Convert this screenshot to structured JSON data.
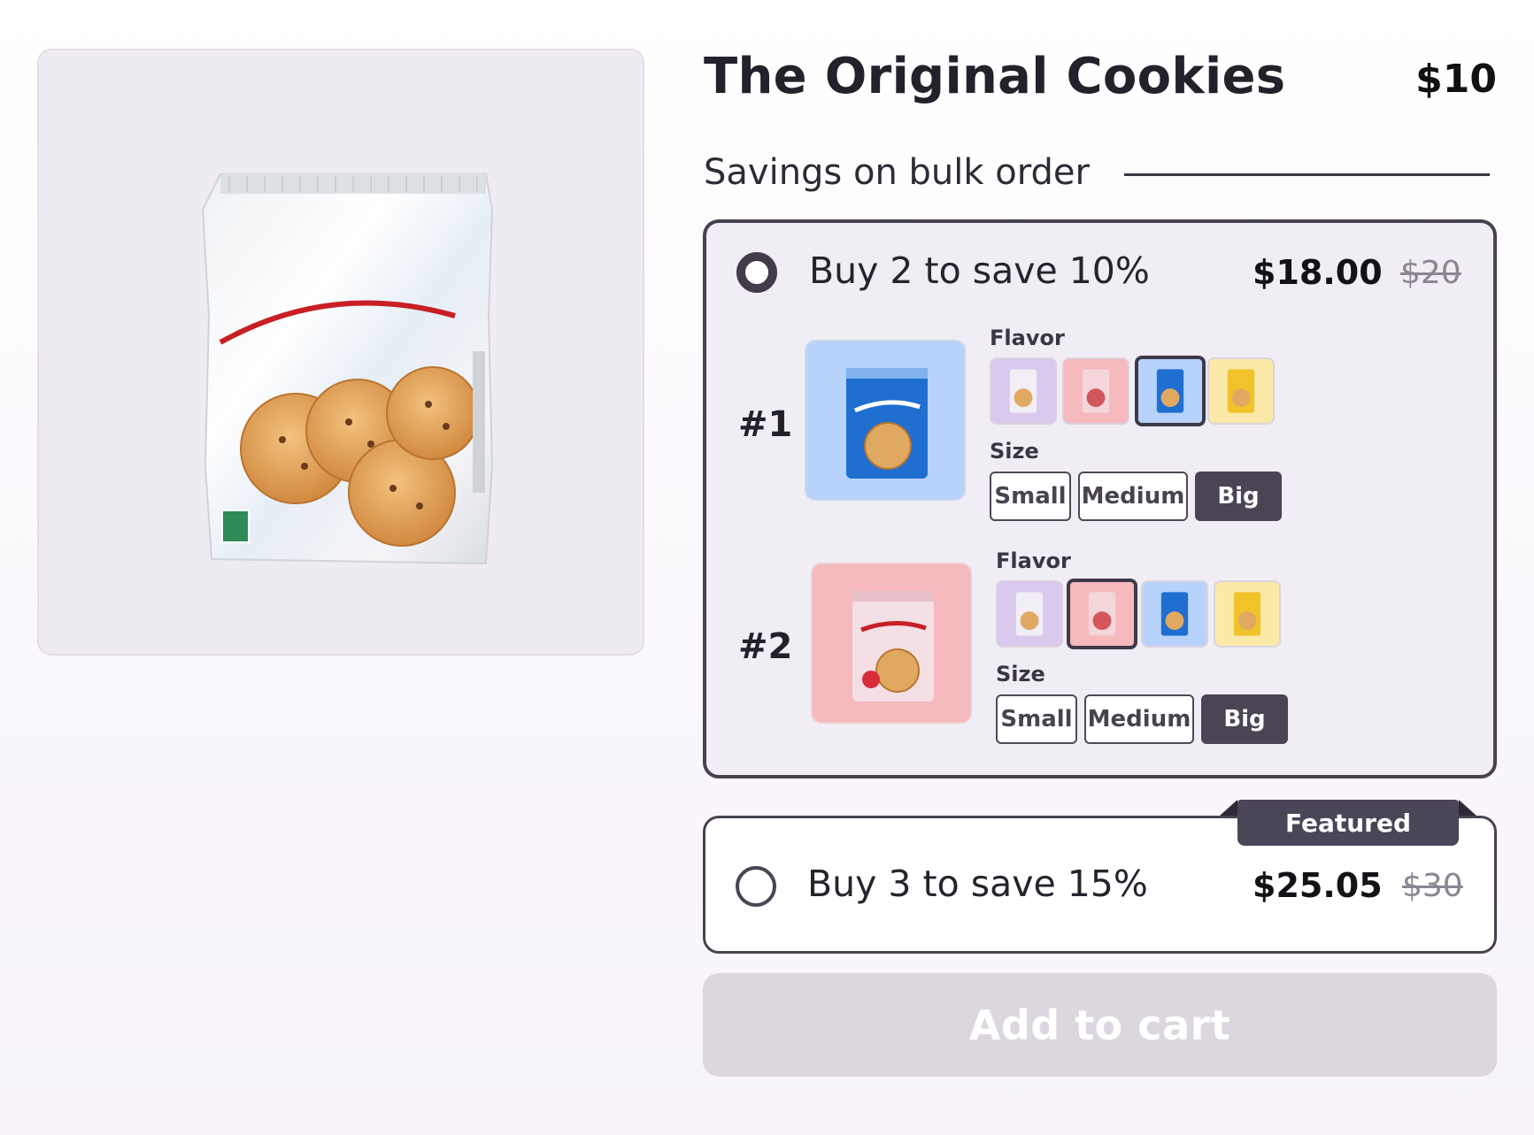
{
  "product": {
    "title": "The Original Cookies",
    "price": "$10",
    "hero_image": "cookie-bag-image"
  },
  "savings": {
    "heading": "Savings on bulk order"
  },
  "offers": [
    {
      "label": "Buy 2 to save 10%",
      "price": "$18.00",
      "old_price": "$20",
      "selected": true,
      "items": [
        {
          "number": "#1",
          "flavor_label": "Flavor",
          "size_label": "Size",
          "selected_flavor": "blue",
          "flavors": [
            "lavender",
            "pink",
            "blue",
            "yellow"
          ],
          "sizes": [
            "Small",
            "Medium",
            "Big"
          ],
          "selected_size": "Big"
        },
        {
          "number": "#2",
          "flavor_label": "Flavor",
          "size_label": "Size",
          "selected_flavor": "pink",
          "flavors": [
            "lavender",
            "pink",
            "blue",
            "yellow"
          ],
          "sizes": [
            "Small",
            "Medium",
            "Big"
          ],
          "selected_size": "Big"
        }
      ]
    },
    {
      "label": "Buy 3 to save 15%",
      "price": "$25.05",
      "old_price": "$30",
      "selected": false,
      "badge": "Featured"
    }
  ],
  "cart": {
    "label": "Add to cart",
    "disabled": true
  },
  "colors": {
    "accent": "#4a4455",
    "lavender": "#d9c9ec",
    "pink": "#f6b9bd",
    "blue": "#b7d3fb",
    "yellow": "#fbe9a8"
  }
}
